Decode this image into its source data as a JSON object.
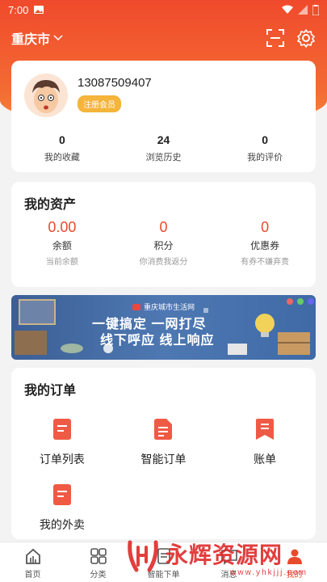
{
  "status_bar": {
    "time": "7:00"
  },
  "header": {
    "city": "重庆市"
  },
  "profile": {
    "phone": "13087509407",
    "member_badge": "注册会员",
    "stats": [
      {
        "value": "0",
        "label": "我的收藏"
      },
      {
        "value": "24",
        "label": "浏览历史"
      },
      {
        "value": "0",
        "label": "我的评价"
      }
    ]
  },
  "assets": {
    "title": "我的资产",
    "items": [
      {
        "value": "0.00",
        "label": "余额",
        "sub": "当前余额"
      },
      {
        "value": "0",
        "label": "积分",
        "sub": "你消费我返分"
      },
      {
        "value": "0",
        "label": "优惠券",
        "sub": "有券不嫌弃贵"
      }
    ]
  },
  "banner": {
    "brand": "重庆城市生活网",
    "line1": "一键搞定 一网打尽",
    "line2": "线下呼应 线上响应"
  },
  "orders": {
    "title": "我的订单",
    "items": [
      {
        "label": "订单列表",
        "icon": "order-list-icon"
      },
      {
        "label": "智能订单",
        "icon": "smart-order-icon"
      },
      {
        "label": "账单",
        "icon": "bill-icon"
      },
      {
        "label": "我的外卖",
        "icon": "takeout-icon"
      }
    ]
  },
  "tabbar": {
    "items": [
      {
        "label": "首页",
        "icon": "home-icon"
      },
      {
        "label": "分类",
        "icon": "category-icon"
      },
      {
        "label": "智能下单",
        "icon": "smart-order-icon"
      },
      {
        "label": "消息",
        "icon": "message-icon"
      },
      {
        "label": "我的",
        "icon": "user-icon"
      }
    ]
  },
  "watermark": {
    "text": "永辉资源网",
    "url": "www.yhkjjj.com"
  },
  "colors": {
    "accent": "#e94a2e",
    "header_gradient_top": "#f04a2c",
    "badge": "#f5b43a",
    "banner_bg": "#4e78b2"
  }
}
